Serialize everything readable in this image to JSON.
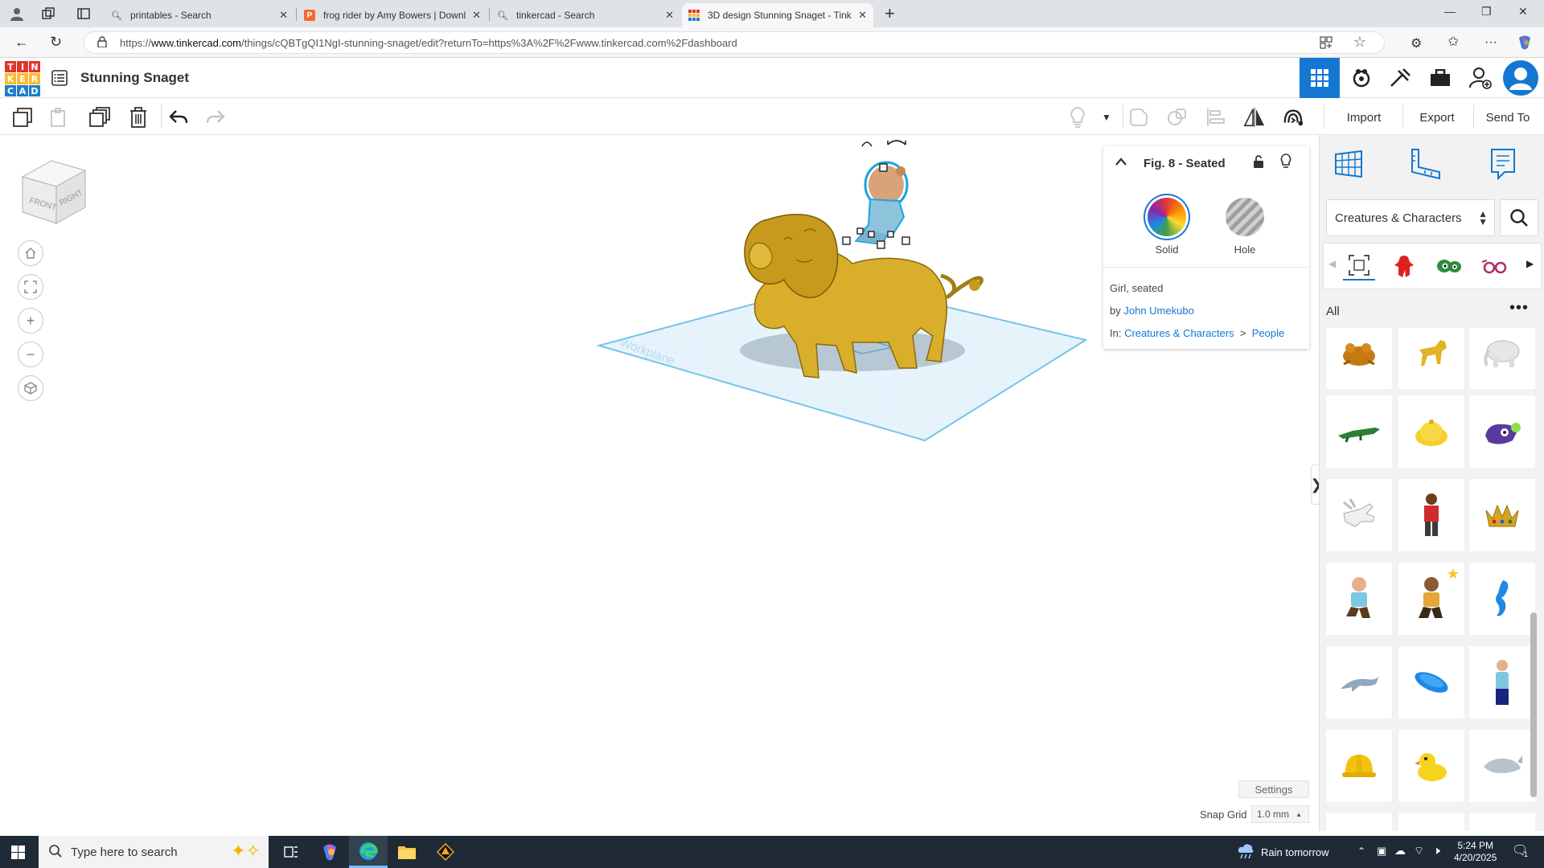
{
  "browser": {
    "tabs": [
      {
        "title": "printables - Search",
        "icon": "search-icon"
      },
      {
        "title": "frog rider by Amy Bowers | Downl",
        "icon": "printables-icon"
      },
      {
        "title": "tinkercad - Search",
        "icon": "search-icon"
      },
      {
        "title": "3D design Stunning Snaget - Tink",
        "icon": "tinkercad-icon",
        "active": true
      }
    ],
    "url_prefix": "https://",
    "url_domain": "www.tinkercad.com",
    "url_path": "/things/cQBTgQI1NgI-stunning-snaget/edit?returnTo=https%3A%2F%2Fwww.tinkercad.com%2Fdashboard"
  },
  "app": {
    "logo_letters": [
      "T",
      "I",
      "N",
      "K",
      "E",
      "R",
      "C",
      "A",
      "D"
    ],
    "logo_colors": [
      "#e3332b",
      "#e3332b",
      "#e3332b",
      "#fdb92e",
      "#fdb92e",
      "#fdb92e",
      "#1e7ecb",
      "#1e7ecb",
      "#1e7ecb"
    ],
    "design_title": "Stunning Snaget",
    "accent": "#1477d2"
  },
  "toolbar": {
    "import_label": "Import",
    "export_label": "Export",
    "send_to_label": "Send To"
  },
  "viewcube": {
    "front": "FRONT",
    "right": "RIGHT"
  },
  "workplane": {
    "label": "Workplane"
  },
  "inspector": {
    "title": "Fig. 8 - Seated",
    "solid_label": "Solid",
    "hole_label": "Hole",
    "description": "Girl, seated",
    "by_prefix": "by",
    "author": "John Umekubo",
    "in_prefix": "In:",
    "category": "Creatures & Characters",
    "crumb_sep": ">",
    "subcategory": "People"
  },
  "library": {
    "category_select": "Creatures & Characters",
    "all_label": "All",
    "more_label": "•••",
    "chips": [
      "all-shapes-icon",
      "red-character-icon",
      "eyes-icon",
      "glasses-icon"
    ],
    "items": [
      "toad",
      "yellow-dog",
      "white-elephant",
      "crocodile",
      "yellow-blob",
      "purple-creature",
      "white-hands",
      "figure-red",
      "gold-crown",
      "figure-seated-blue",
      "figure-seated-brown",
      "blue-seahorse",
      "dolphin",
      "blue-disc",
      "figure-standing-blue",
      "hardhat",
      "rubber-duck",
      "whale"
    ]
  },
  "canvas_footer": {
    "settings_label": "Settings",
    "snap_grid_label": "Snap Grid",
    "snap_grid_value": "1.0 mm"
  },
  "taskbar": {
    "search_placeholder": "Type here to search",
    "weather": "Rain tomorrow",
    "time": "5:24 PM",
    "date": "4/20/2025",
    "notification_count": "1"
  }
}
